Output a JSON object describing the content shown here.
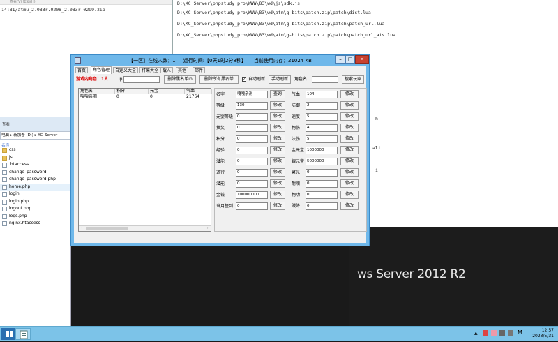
{
  "bg_left": {
    "menu": "查看(V)   帮助(H)",
    "zip_line": "14:81/atmu_2.083r.0208_2.083r.0299.zip"
  },
  "bg_right": {
    "lines": [
      "D:\\XC_Server\\phpstudy_pro\\WWW\\83\\wd\\js\\sdk.js",
      "D:\\XC_Server\\phpstudy_pro\\WWW\\83\\wd\\atm\\g-bits\\patch.zip\\patch\\dist.lua",
      "D:\\XC_Server\\phpstudy_pro\\WWW\\83\\wd\\atm\\g-bits\\patch.zip\\patch\\patch_url.lua",
      "D:\\XC_Server\\phpstudy_pro\\WWW\\83\\wd\\atm\\g-bits\\patch.zip\\patch\\patch_url_ats.lua"
    ],
    "frag_a": "h",
    "frag_b": "ali",
    "frag_c": "i"
  },
  "server_text": "ws Server 2012 R2",
  "explorer": {
    "view_label": "查看",
    "address": "电脑 ▸ 新加卷 (D:) ▸ XC_Server",
    "col_name": "名称",
    "files": [
      {
        "name": "css",
        "type": "folder"
      },
      {
        "name": "js",
        "type": "folder"
      },
      {
        "name": ".htaccess",
        "type": "file"
      },
      {
        "name": "change_password",
        "type": "file"
      },
      {
        "name": "change_password.php",
        "type": "file"
      },
      {
        "name": "home.php",
        "type": "file"
      },
      {
        "name": "login",
        "type": "file"
      },
      {
        "name": "login.php",
        "type": "file"
      },
      {
        "name": "logout.php",
        "type": "file"
      },
      {
        "name": "logs.php",
        "type": "file"
      },
      {
        "name": "nginx.htaccess",
        "type": "file"
      }
    ]
  },
  "taskbar": {
    "time": "12:57",
    "date": "2023/5/31",
    "ime": "M"
  },
  "app": {
    "title": "【一区】在线人数：1     运行时间:【0天1时2分8秒】     当前使用内存：21024 KB",
    "tabs": [
      "首页",
      "角色管理",
      "自定义大全",
      "打菜大全",
      "载人",
      "其他",
      "邮件"
    ],
    "active_tab": 1,
    "toolbar": {
      "online_label": "游戏内角色：1人",
      "ip_label": "ip",
      "ip_value": "",
      "blacklist_ip_btn": "删除黑名单ip",
      "blacklist_all_btn": "删除所有黑名单",
      "auto_refresh_label": "自动刷新",
      "auto_refresh_checked": true,
      "manual_refresh_btn": "手动刷新",
      "role_name_label": "角色名",
      "role_name_value": "",
      "search_btn": "搜索玩家"
    },
    "list": {
      "headers": [
        "角色名",
        "积分",
        "元宝",
        "气血"
      ],
      "rows": [
        [
          "嘎嘎亲测",
          "0",
          "0",
          "21764"
        ]
      ]
    },
    "panel": {
      "left": [
        {
          "label": "名字",
          "value": "嘎嘎亲测",
          "btn": "查询"
        },
        {
          "label": "等级",
          "value": "130",
          "btn": "修改"
        },
        {
          "label": "元婴等级",
          "value": "0",
          "btn": "修改"
        },
        {
          "label": "抽奖",
          "value": "0",
          "btn": "修改"
        },
        {
          "label": "积分",
          "value": "0",
          "btn": "修改"
        },
        {
          "label": "经验",
          "value": "0",
          "btn": "修改"
        },
        {
          "label": "潜能",
          "value": "0",
          "btn": "修改"
        },
        {
          "label": "道行",
          "value": "0",
          "btn": "修改"
        },
        {
          "label": "潜能",
          "value": "0",
          "btn": "修改"
        },
        {
          "label": "金钱",
          "value": "100000000",
          "btn": "修改"
        },
        {
          "label": "当月签到",
          "value": "0",
          "btn": "修改"
        }
      ],
      "right": [
        {
          "label": "气血",
          "value": "104",
          "btn": "修改"
        },
        {
          "label": "防御",
          "value": "2",
          "btn": "修改"
        },
        {
          "label": "速度",
          "value": "5",
          "btn": "修改"
        },
        {
          "label": "物伤",
          "value": "4",
          "btn": "修改"
        },
        {
          "label": "法伤",
          "value": "5",
          "btn": "修改"
        },
        {
          "label": "金元宝",
          "value": "1000000",
          "btn": "修改"
        },
        {
          "label": "银元宝",
          "value": "5000000",
          "btn": "修改"
        },
        {
          "label": "繁光",
          "value": "0",
          "btn": "修改"
        },
        {
          "label": "耐魂",
          "value": "0",
          "btn": "修改"
        },
        {
          "label": "物功",
          "value": "0",
          "btn": "修改"
        },
        {
          "label": "贼降",
          "value": "0",
          "btn": "修改"
        }
      ]
    }
  }
}
